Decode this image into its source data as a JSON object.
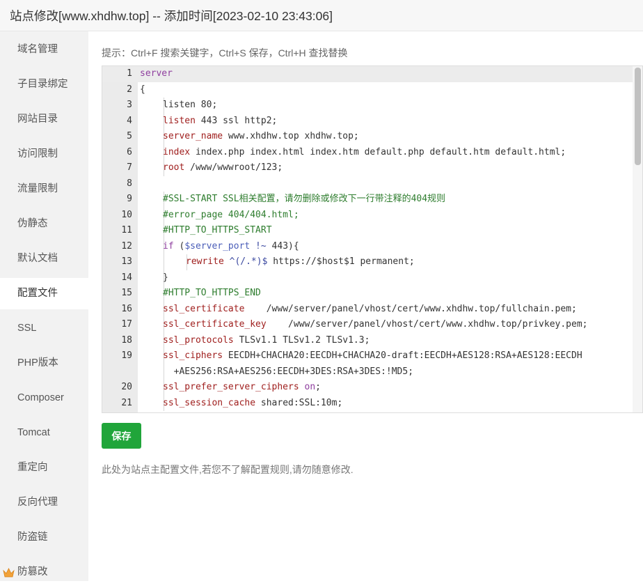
{
  "window": {
    "title": "站点修改[www.xhdhw.top] -- 添加时间[2023-02-10 23:43:06]"
  },
  "sidebar": {
    "items": [
      {
        "label": "域名管理"
      },
      {
        "label": "子目录绑定"
      },
      {
        "label": "网站目录"
      },
      {
        "label": "访问限制"
      },
      {
        "label": "流量限制"
      },
      {
        "label": "伪静态"
      },
      {
        "label": "默认文档"
      },
      {
        "label": "配置文件",
        "active": true
      },
      {
        "label": "SSL"
      },
      {
        "label": "PHP版本"
      },
      {
        "label": "Composer"
      },
      {
        "label": "Tomcat"
      },
      {
        "label": "重定向"
      },
      {
        "label": "反向代理"
      },
      {
        "label": "防盗链"
      },
      {
        "label": "防篡改",
        "icon": "crown-icon"
      }
    ]
  },
  "main": {
    "hint": "提示：Ctrl+F 搜索关键字，Ctrl+S 保存，Ctrl+H 查找替换",
    "save_label": "保存",
    "note": "此处为站点主配置文件,若您不了解配置规则,请勿随意修改."
  },
  "editor": {
    "active_line": 1,
    "scroll_position": 0.0,
    "lines": [
      {
        "num": "1",
        "indent": 0,
        "tokens": [
          {
            "t": "server",
            "c": "kw"
          }
        ]
      },
      {
        "num": "2",
        "indent": 0,
        "tokens": [
          {
            "t": "{",
            "c": ""
          }
        ]
      },
      {
        "num": "3",
        "indent": 1,
        "tokens": [
          {
            "t": "listen 80;",
            "c": ""
          }
        ]
      },
      {
        "num": "4",
        "indent": 1,
        "tokens": [
          {
            "t": "listen",
            "c": "dir"
          },
          {
            "t": " 443 ssl http2;",
            "c": ""
          }
        ]
      },
      {
        "num": "5",
        "indent": 1,
        "tokens": [
          {
            "t": "server_name",
            "c": "dir"
          },
          {
            "t": " www.xhdhw.top xhdhw.top;",
            "c": ""
          }
        ]
      },
      {
        "num": "6",
        "indent": 1,
        "tokens": [
          {
            "t": "index",
            "c": "dir"
          },
          {
            "t": " index.php index.html index.htm default.php default.htm default.html;",
            "c": ""
          }
        ]
      },
      {
        "num": "7",
        "indent": 1,
        "tokens": [
          {
            "t": "root",
            "c": "dir"
          },
          {
            "t": " /www/wwwroot/123;",
            "c": ""
          }
        ]
      },
      {
        "num": "8",
        "indent": 0,
        "tokens": []
      },
      {
        "num": "9",
        "indent": 1,
        "tokens": [
          {
            "t": "#SSL-START SSL相关配置，请勿删除或修改下一行带注释的404规则",
            "c": "cm"
          }
        ]
      },
      {
        "num": "10",
        "indent": 1,
        "tokens": [
          {
            "t": "#error_page 404/404.html;",
            "c": "cm"
          }
        ]
      },
      {
        "num": "11",
        "indent": 1,
        "tokens": [
          {
            "t": "#HTTP_TO_HTTPS_START",
            "c": "cm"
          }
        ]
      },
      {
        "num": "12",
        "indent": 1,
        "tokens": [
          {
            "t": "if",
            "c": "kw"
          },
          {
            "t": " (",
            "c": ""
          },
          {
            "t": "$server_port",
            "c": "var"
          },
          {
            "t": " !~ ",
            "c": "str"
          },
          {
            "t": "443",
            "c": ""
          },
          {
            "t": "){",
            "c": ""
          }
        ]
      },
      {
        "num": "13",
        "indent": 2,
        "tokens": [
          {
            "t": "rewrite",
            "c": "dir"
          },
          {
            "t": " ^(/.*)$",
            "c": "str"
          },
          {
            "t": " https://$host$1 permanent;",
            "c": ""
          }
        ]
      },
      {
        "num": "14",
        "indent": 1,
        "tokens": [
          {
            "t": "}",
            "c": ""
          }
        ]
      },
      {
        "num": "15",
        "indent": 1,
        "tokens": [
          {
            "t": "#HTTP_TO_HTTPS_END",
            "c": "cm"
          }
        ]
      },
      {
        "num": "16",
        "indent": 1,
        "tokens": [
          {
            "t": "ssl_certificate",
            "c": "dir"
          },
          {
            "t": "    /www/server/panel/vhost/cert/www.xhdhw.top/fullchain.pem;",
            "c": ""
          }
        ]
      },
      {
        "num": "17",
        "indent": 1,
        "tokens": [
          {
            "t": "ssl_certificate_key",
            "c": "dir"
          },
          {
            "t": "    /www/server/panel/vhost/cert/www.xhdhw.top/privkey.pem;",
            "c": ""
          }
        ]
      },
      {
        "num": "18",
        "indent": 1,
        "tokens": [
          {
            "t": "ssl_protocols",
            "c": "dir"
          },
          {
            "t": " TLSv1.1 TLSv1.2 TLSv1.3;",
            "c": ""
          }
        ]
      },
      {
        "num": "19",
        "indent": 1,
        "tokens": [
          {
            "t": "ssl_ciphers",
            "c": "dir"
          },
          {
            "t": " EECDH+CHACHA20:EECDH+CHACHA20-draft:EECDH+AES128:RSA+AES128:EECDH",
            "c": ""
          }
        ]
      },
      {
        "num": "",
        "indent": 1,
        "wrap": true,
        "tokens": [
          {
            "t": "  +AES256:RSA+AES256:EECDH+3DES:RSA+3DES:!MD5;",
            "c": ""
          }
        ]
      },
      {
        "num": "20",
        "indent": 1,
        "tokens": [
          {
            "t": "ssl_prefer_server_ciphers",
            "c": "dir"
          },
          {
            "t": " ",
            "c": ""
          },
          {
            "t": "on",
            "c": "kw"
          },
          {
            "t": ";",
            "c": ""
          }
        ]
      },
      {
        "num": "21",
        "indent": 1,
        "tokens": [
          {
            "t": "ssl_session_cache",
            "c": "dir"
          },
          {
            "t": " shared:SSL:10m;",
            "c": ""
          }
        ]
      }
    ]
  }
}
